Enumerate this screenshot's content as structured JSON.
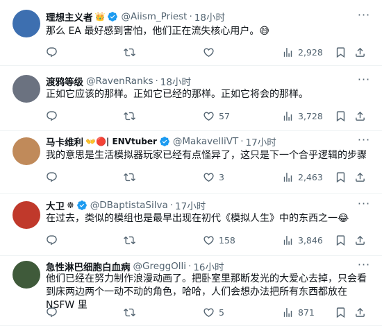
{
  "tweets": [
    {
      "name": "理想主义者",
      "name_emoji": "👑",
      "verified": true,
      "handle": "@Aiism_Priest",
      "time": "18小时",
      "text": "那么 EA 最好感到害怕，他们正在流失核心用户。😅",
      "replies": "",
      "retweets": "",
      "likes": "",
      "views": "2,928",
      "avatar_color": "#3d6fb0"
    },
    {
      "name": "渡鸦等级",
      "name_emoji": "",
      "verified": false,
      "handle": "@RavenRanks",
      "time": "18小时",
      "text": "正如它应该的那样。正如它已经的那样。正如它将会的那样。",
      "replies": "",
      "retweets": "",
      "likes": "57",
      "views": "3,728",
      "avatar_color": "#6b7280"
    },
    {
      "name": "马卡维利",
      "name_emoji": "👐🔴| ENVtuber",
      "verified": true,
      "handle": "@MakavelliVT",
      "time": "17小时",
      "text": "我的意思是生活模拟器玩家已经有点怪异了，这只是下一个合乎逻辑的步骤",
      "replies": "",
      "retweets": "",
      "likes": "3",
      "views": "2,463",
      "avatar_color": "#c08a5a"
    },
    {
      "name": "大卫",
      "name_emoji": "☸",
      "verified": true,
      "handle": "@DBaptistaSilva",
      "time": "17小时",
      "text": "在过去，类似的模组也是最早出现在初代《模拟人生》中的东西之一😂",
      "replies": "",
      "retweets": "",
      "likes": "158",
      "views": "3,846",
      "avatar_color": "#c0392b"
    },
    {
      "name": "急性淋巴细胞白血病",
      "name_emoji": "",
      "verified": false,
      "handle": "@GreggOlli",
      "time": "16小时",
      "text": "他们已经在努力制作浪漫动画了。把卧室里那断发光的大爱心去掉，只会看到床两边两个一动不动的角色，哈哈，人们会想办法把所有东西都放在 NSFW 里",
      "replies": "",
      "retweets": "",
      "likes": "5",
      "views": "871",
      "avatar_color": "#3f5a3a"
    }
  ],
  "icons": {
    "reply": "reply-icon",
    "retweet": "retweet-icon",
    "like": "like-icon",
    "views": "views-icon",
    "bookmark": "bookmark-icon",
    "share": "share-icon",
    "more": "more-icon",
    "verified": "verified-badge-icon"
  },
  "colors": {
    "verified_badge": "#1d9bf0",
    "secondary_text": "#536471",
    "divider": "#eff3f4"
  }
}
